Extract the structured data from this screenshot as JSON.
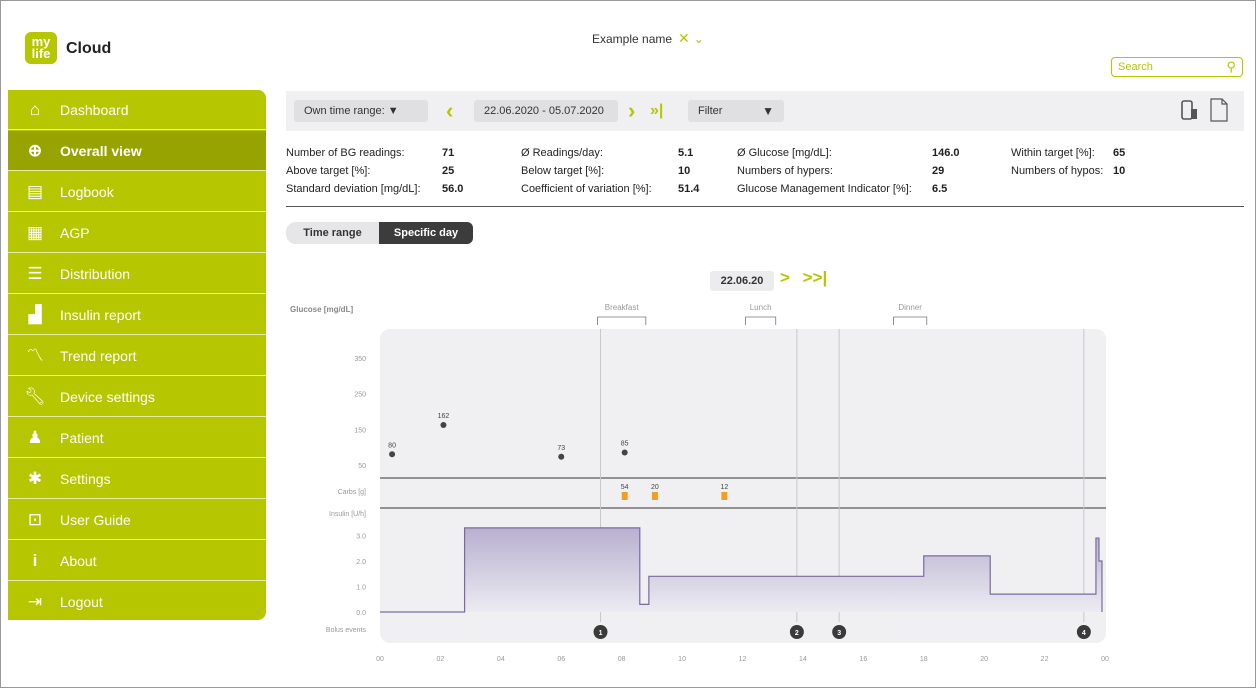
{
  "app": {
    "logo_text": "my life",
    "brand": "Cloud"
  },
  "user": {
    "name": "Example name"
  },
  "search": {
    "placeholder": "Search"
  },
  "sidebar": {
    "items": [
      {
        "label": "Dashboard",
        "icon": "home-icon"
      },
      {
        "label": "Overall view",
        "icon": "magnifier-chart-icon",
        "active": true
      },
      {
        "label": "Logbook",
        "icon": "document-icon"
      },
      {
        "label": "AGP",
        "icon": "calendar-icon"
      },
      {
        "label": "Distribution",
        "icon": "lines-icon"
      },
      {
        "label": "Insulin report",
        "icon": "bar-chart-icon"
      },
      {
        "label": "Trend report",
        "icon": "trend-icon"
      },
      {
        "label": "Device settings",
        "icon": "wrench-icon"
      },
      {
        "label": "Patient",
        "icon": "person-icon"
      },
      {
        "label": "Settings",
        "icon": "gear-icon"
      },
      {
        "label": "User Guide",
        "icon": "book-icon"
      },
      {
        "label": "About",
        "icon": "info-icon"
      },
      {
        "label": "Logout",
        "icon": "logout-icon"
      }
    ]
  },
  "toolbar": {
    "time_range": "Own time range: ▼",
    "date_range": "22.06.2020 - 05.07.2020",
    "filter": "Filter"
  },
  "stats": {
    "bg_readings_label": "Number of BG readings:",
    "bg_readings": "71",
    "above_label": "Above target [%]:",
    "above": "25",
    "sd_label": "Standard deviation [mg/dL]:",
    "sd": "56.0",
    "readings_day_label": "Ø Readings/day:",
    "readings_day": "5.1",
    "below_label": "Below target [%]:",
    "below": "10",
    "cv_label": "Coefficient of variation [%]:",
    "cv": "51.4",
    "glucose_label": "Ø Glucose [mg/dL]:",
    "glucose": "146.0",
    "hypers_label": "Numbers of hypers:",
    "hypers": "29",
    "gmi_label": "Glucose Management Indicator [%]:",
    "gmi": "6.5",
    "within_label": "Within target [%]:",
    "within": "65",
    "hypos_label": "Numbers of hypos:",
    "hypos": "10"
  },
  "tabs": {
    "time_range": "Time range",
    "specific_day": "Specific day"
  },
  "day": {
    "date": "22.06.20",
    "next": ">",
    "last": ">>|"
  },
  "colors": {
    "accent": "#b6c600",
    "accent_dark": "#96a300",
    "insulin": "#7a6a9e"
  },
  "chart_data": {
    "type": "line",
    "glucose_label": "Glucose [mg/dL]",
    "carbs_label": "Carbs [g]",
    "insulin_label": "Insulin [U/h]",
    "bolus_label": "Bolus events",
    "glucose_ticks": [
      "350",
      "250",
      "150",
      "50"
    ],
    "insulin_ticks": [
      "3.0",
      "2.0",
      "1.0",
      "0.0"
    ],
    "x_ticks": [
      "00",
      "02",
      "04",
      "06",
      "08",
      "10",
      "12",
      "14",
      "16",
      "18",
      "20",
      "22",
      "00"
    ],
    "meals": [
      {
        "label": "Breakfast",
        "start": 7.2,
        "end": 8.8
      },
      {
        "label": "Lunch",
        "start": 12.1,
        "end": 13.1
      },
      {
        "label": "Dinner",
        "start": 17.0,
        "end": 18.1
      }
    ],
    "glucose": [
      {
        "x": 0.4,
        "y": 80,
        "label": "80"
      },
      {
        "x": 2.1,
        "y": 162,
        "label": "162"
      },
      {
        "x": 6.0,
        "y": 73,
        "label": "73"
      },
      {
        "x": 8.1,
        "y": 85,
        "label": "85"
      }
    ],
    "carbs": [
      {
        "x": 8.1,
        "label": "54"
      },
      {
        "x": 9.1,
        "label": "20"
      },
      {
        "x": 11.4,
        "label": "12"
      }
    ],
    "basal": [
      [
        0,
        0
      ],
      [
        2.8,
        0
      ],
      [
        2.8,
        3.3
      ],
      [
        8.6,
        3.3
      ],
      [
        8.6,
        0.3
      ],
      [
        8.9,
        0.3
      ],
      [
        8.9,
        1.4
      ],
      [
        18.0,
        1.4
      ],
      [
        18.0,
        2.2
      ],
      [
        20.2,
        2.2
      ],
      [
        20.2,
        0.7
      ],
      [
        23.0,
        0.7
      ],
      [
        23.0,
        0.7
      ],
      [
        23.7,
        0.7
      ],
      [
        23.7,
        2.9
      ],
      [
        23.8,
        2.9
      ],
      [
        23.8,
        2.0
      ],
      [
        23.9,
        2.0
      ],
      [
        23.9,
        0
      ]
    ],
    "bolus_events": [
      {
        "x": 7.3,
        "label": "1"
      },
      {
        "x": 13.8,
        "label": "2"
      },
      {
        "x": 15.2,
        "label": "3"
      },
      {
        "x": 23.3,
        "label": "4"
      }
    ]
  }
}
